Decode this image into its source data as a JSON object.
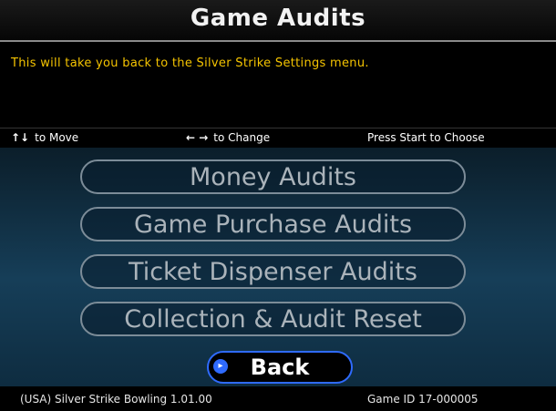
{
  "header": {
    "title": "Game Audits"
  },
  "info": {
    "text": "This will take you back to the Silver Strike Settings menu."
  },
  "help": {
    "move_arrows": "↑↓",
    "move_text": "to Move",
    "change_arrows": "← →",
    "change_text": "to Change",
    "choose_text": "Press Start to Choose"
  },
  "menu": {
    "items": [
      {
        "label": "Money Audits"
      },
      {
        "label": "Game Purchase Audits"
      },
      {
        "label": "Ticket Dispenser Audits"
      },
      {
        "label": "Collection & Audit Reset"
      }
    ],
    "back_label": "Back",
    "back_cursor": "▸"
  },
  "footer": {
    "left": "(USA) Silver Strike Bowling 1.01.00",
    "right": "Game ID 17-000005"
  },
  "colors": {
    "info_text": "#f5c400",
    "selected_outline": "#2f6bff",
    "button_text": "#aab3ba"
  }
}
